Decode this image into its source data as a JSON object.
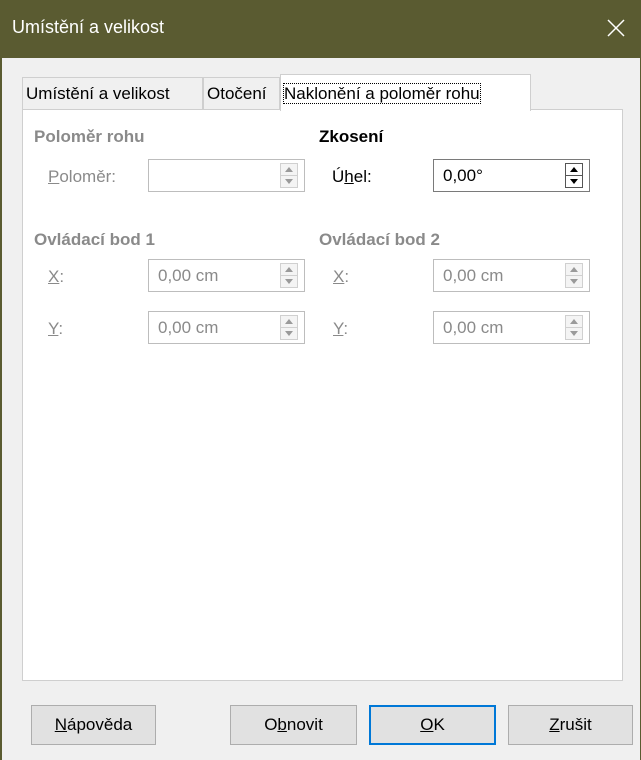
{
  "window": {
    "title": "Umístění a velikost"
  },
  "tabs": [
    {
      "label": "Umístění a velikost",
      "active": false
    },
    {
      "label": "Otočení",
      "active": false
    },
    {
      "label": "Naklonění a poloměr rohu",
      "active": true
    }
  ],
  "corner_radius": {
    "heading": "Poloměr rohu",
    "radius_label_prefix": "P",
    "radius_label_rest": "oloměr:",
    "radius_value": ""
  },
  "slant": {
    "heading": "Zkosení",
    "angle_label_prefix": "Ú",
    "angle_label_accel": "h",
    "angle_label_rest": "el:",
    "angle_value": "0,00°"
  },
  "control_point_1": {
    "heading": "Ovládací bod 1",
    "x_label_accel": "X",
    "x_label_rest": ":",
    "x_value": "0,00 cm",
    "y_label_accel": "Y",
    "y_label_rest": ":",
    "y_value": "0,00 cm"
  },
  "control_point_2": {
    "heading": "Ovládací bod 2",
    "x_label_accel": "X",
    "x_label_rest": ":",
    "x_value": "0,00 cm",
    "y_label_accel": "Y",
    "y_label_rest": ":",
    "y_value": "0,00 cm"
  },
  "buttons": {
    "help_accel": "N",
    "help_rest": "ápověda",
    "reset_pre": "O",
    "reset_accel": "b",
    "reset_rest": "novit",
    "ok_accel": "O",
    "ok_rest": "K",
    "cancel_accel": "Z",
    "cancel_rest": "rušit"
  },
  "colors": {
    "titlebar": "#5a5b31",
    "default_button_border": "#0078d7",
    "disabled_text": "#8a8a8a"
  }
}
